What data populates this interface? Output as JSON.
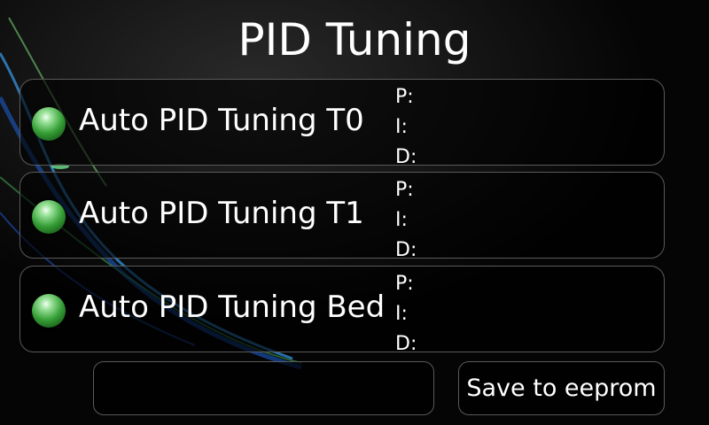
{
  "screen": {
    "title": "PID Tuning"
  },
  "rows": [
    {
      "label": "Auto PID Tuning T0",
      "p_label": "P:",
      "i_label": "I:",
      "d_label": "D:"
    },
    {
      "label": "Auto PID Tuning T1",
      "p_label": "P:",
      "i_label": "I:",
      "d_label": "D:"
    },
    {
      "label": "Auto PID Tuning Bed",
      "p_label": "P:",
      "i_label": "I:",
      "d_label": "D:"
    }
  ],
  "footer": {
    "status_text": "",
    "save_label": "Save to eeprom"
  },
  "icons": {
    "led": "green-led-indicator-icon"
  },
  "colors": {
    "background": "#050505",
    "panel_border": "#5a5a5a",
    "text": "#ffffff",
    "led": "#37a037"
  }
}
